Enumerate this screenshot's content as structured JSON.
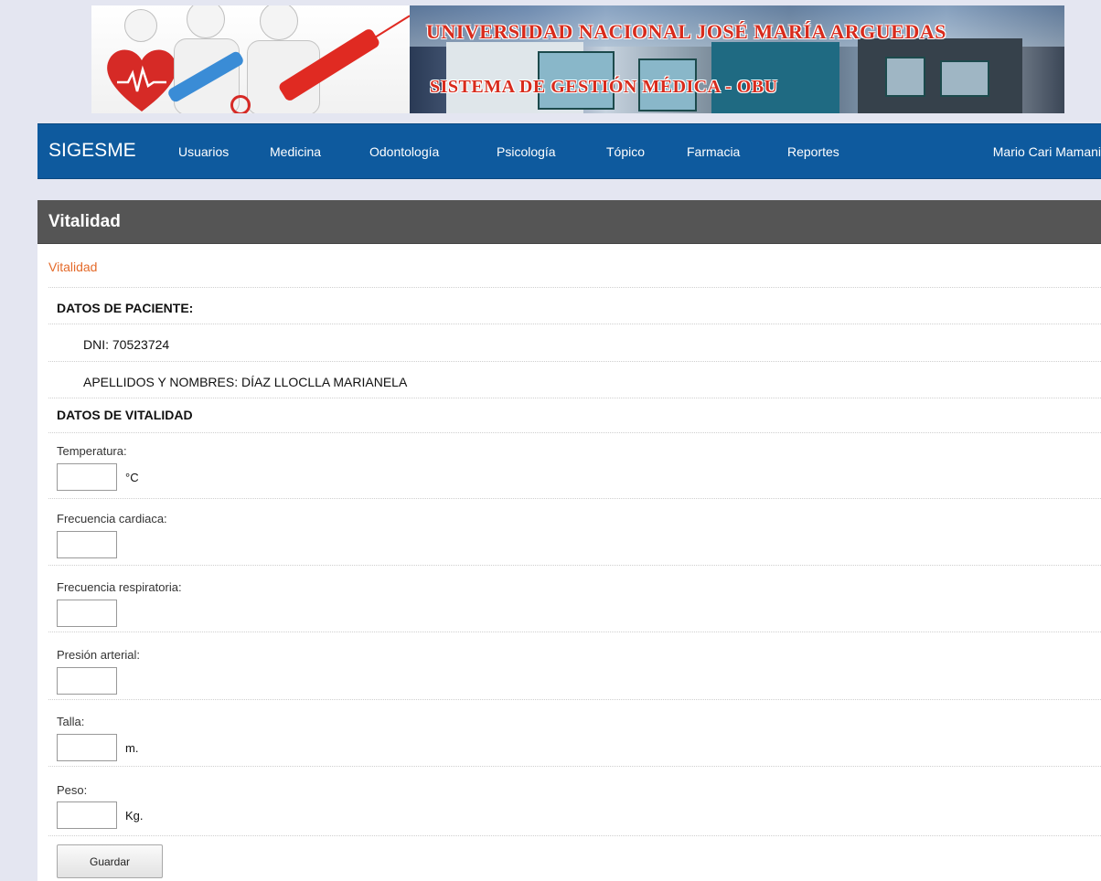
{
  "banner": {
    "university": "UNIVERSIDAD NACIONAL JOSÉ MARÍA ARGUEDAS",
    "system": "SISTEMA DE GESTIÓN MÉDICA - OBU"
  },
  "nav": {
    "brand": "SIGESME",
    "items": [
      "Usuarios",
      "Medicina",
      "Odontología",
      "Psicología",
      "Tópico",
      "Farmacia",
      "Reportes"
    ],
    "user": "Mario Cari Mamani",
    "bg_color": "#0e5a9e"
  },
  "panel": {
    "title": "Vitalidad",
    "breadcrumb": "Vitalidad"
  },
  "patient": {
    "section_title": "DATOS DE PACIENTE:",
    "dni": "DNI: 70523724",
    "name": "APELLIDOS Y NOMBRES: DÍAZ LLOCLLA MARIANELA"
  },
  "vitals": {
    "section_title": "DATOS DE VITALIDAD",
    "fields": [
      {
        "label": "Temperatura:",
        "value": "",
        "unit": "°C"
      },
      {
        "label": "Frecuencia cardiaca:",
        "value": "",
        "unit": ""
      },
      {
        "label": "Frecuencia respiratoria:",
        "value": "",
        "unit": ""
      },
      {
        "label": "Presión arterial:",
        "value": "",
        "unit": ""
      },
      {
        "label": "Talla:",
        "value": "",
        "unit": "m."
      },
      {
        "label": "Peso:",
        "value": "",
        "unit": "Kg."
      }
    ]
  },
  "actions": {
    "save": "Guardar"
  }
}
